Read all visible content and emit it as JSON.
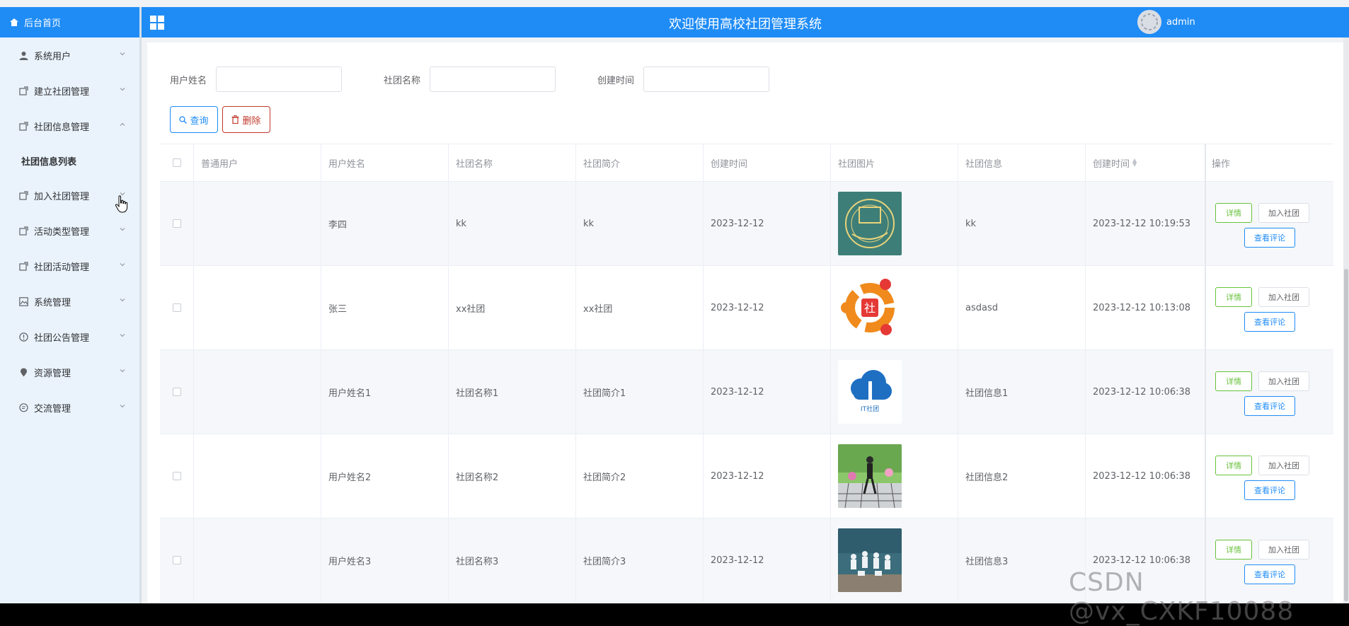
{
  "sidebar": {
    "home_label": "后台首页",
    "menu": [
      {
        "label": "系统用户",
        "icon": "user-icon"
      },
      {
        "label": "建立社团管理",
        "icon": "share-icon"
      },
      {
        "label": "社团信息管理",
        "icon": "share-icon",
        "expanded": true
      },
      {
        "label": "加入社团管理",
        "icon": "share-icon"
      },
      {
        "label": "活动类型管理",
        "icon": "share-icon"
      },
      {
        "label": "社团活动管理",
        "icon": "share-icon"
      },
      {
        "label": "系统管理",
        "icon": "picture-icon"
      },
      {
        "label": "社团公告管理",
        "icon": "info-icon"
      },
      {
        "label": "资源管理",
        "icon": "location-icon"
      },
      {
        "label": "交流管理",
        "icon": "chat-icon"
      }
    ],
    "submenu_label": "社团信息列表"
  },
  "header": {
    "title": "欢迎使用高校社团管理系统",
    "username": "admin"
  },
  "search": {
    "fields": [
      {
        "label": "用户姓名",
        "value": ""
      },
      {
        "label": "社团名称",
        "value": ""
      },
      {
        "label": "创建时间",
        "value": ""
      }
    ],
    "query_label": "查询",
    "delete_label": "删除"
  },
  "table": {
    "columns": [
      "普通用户",
      "用户姓名",
      "社团名称",
      "社团简介",
      "创建时间",
      "社团图片",
      "社团信息",
      "创建时间",
      "操作"
    ],
    "rows": [
      {
        "user": "",
        "name": "李四",
        "club": "kk",
        "intro": "kk",
        "date": "2023-12-12",
        "image": "logo-teal",
        "info": "kk",
        "created": "2023-12-12 10:19:53"
      },
      {
        "user": "",
        "name": "张三",
        "club": "xx社团",
        "intro": "xx社团",
        "date": "2023-12-12",
        "image": "logo-orange",
        "info": "asdasd",
        "created": "2023-12-12 10:13:08"
      },
      {
        "user": "",
        "name": "用户姓名1",
        "club": "社团名称1",
        "intro": "社团简介1",
        "date": "2023-12-12",
        "image": "logo-cloud",
        "info": "社团信息1",
        "created": "2023-12-12 10:06:38"
      },
      {
        "user": "",
        "name": "用户姓名2",
        "club": "社团名称2",
        "intro": "社团简介2",
        "date": "2023-12-12",
        "image": "photo-dance",
        "info": "社团信息2",
        "created": "2023-12-12 10:06:38"
      },
      {
        "user": "",
        "name": "用户姓名3",
        "club": "社团名称3",
        "intro": "社团简介3",
        "date": "2023-12-12",
        "image": "photo-group",
        "info": "社团信息3",
        "created": "2023-12-12 10:06:38"
      }
    ],
    "op_detail": "详情",
    "op_join": "加入社团",
    "op_review": "查看评论",
    "cloud_caption": "IT社团"
  },
  "watermark": "CSDN @vx_CXKF10088",
  "colors": {
    "primary": "#1f8cf6",
    "success": "#67c23a",
    "danger": "#c0392b",
    "sidebar_bg": "#eaf3fc"
  }
}
